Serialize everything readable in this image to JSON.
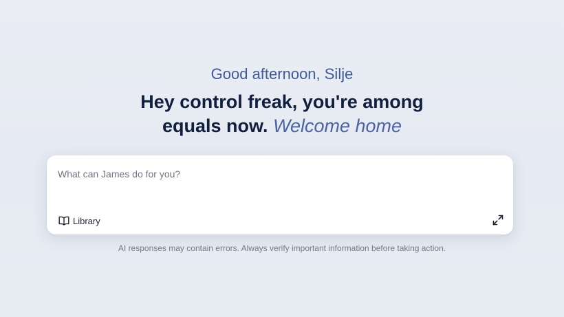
{
  "greeting": "Good afternoon, Silje",
  "headline": {
    "line1": "Hey control freak, you're among",
    "line2_bold": "equals now.",
    "line2_accent": "Welcome home"
  },
  "prompt": {
    "placeholder": "What can James do for you?",
    "value": "",
    "library_label": "Library",
    "library_icon": "open-book-icon",
    "expand_icon": "expand-arrows-icon"
  },
  "disclaimer": "AI responses may contain errors. Always verify important information before taking action.",
  "colors": {
    "greeting": "#3f5a95",
    "headline": "#0f1f3d",
    "accent": "#4a63a3",
    "background": "#e8ecf3"
  }
}
